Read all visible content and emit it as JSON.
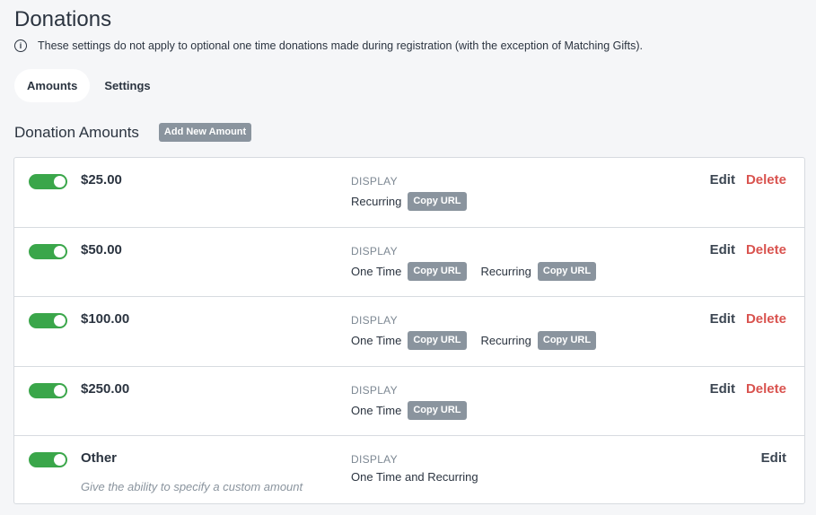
{
  "page": {
    "title": "Donations",
    "notice": "These settings do not apply to optional one time donations made during registration (with the exception of Matching Gifts).",
    "info_icon": "info-circle-icon"
  },
  "tabs": [
    {
      "label": "Amounts",
      "active": true
    },
    {
      "label": "Settings",
      "active": false
    }
  ],
  "section": {
    "title": "Donation Amounts",
    "add_button": "Add New Amount"
  },
  "labels": {
    "display": "DISPLAY",
    "copy_url": "Copy URL",
    "edit": "Edit",
    "delete": "Delete"
  },
  "rows": [
    {
      "amount": "$25.00",
      "enabled": true,
      "options": [
        "Recurring"
      ]
    },
    {
      "amount": "$50.00",
      "enabled": true,
      "options": [
        "One Time",
        "Recurring"
      ]
    },
    {
      "amount": "$100.00",
      "enabled": true,
      "options": [
        "One Time",
        "Recurring"
      ]
    },
    {
      "amount": "$250.00",
      "enabled": true,
      "options": [
        "One Time"
      ]
    },
    {
      "amount": "Other",
      "enabled": true,
      "description": "Give the ability to specify a custom amount",
      "display_text": "One Time and Recurring"
    }
  ],
  "colors": {
    "toggle_on": "#3aa64a",
    "delete": "#d9534f",
    "button_gray": "#8a949e",
    "background": "#f5f6f8"
  }
}
